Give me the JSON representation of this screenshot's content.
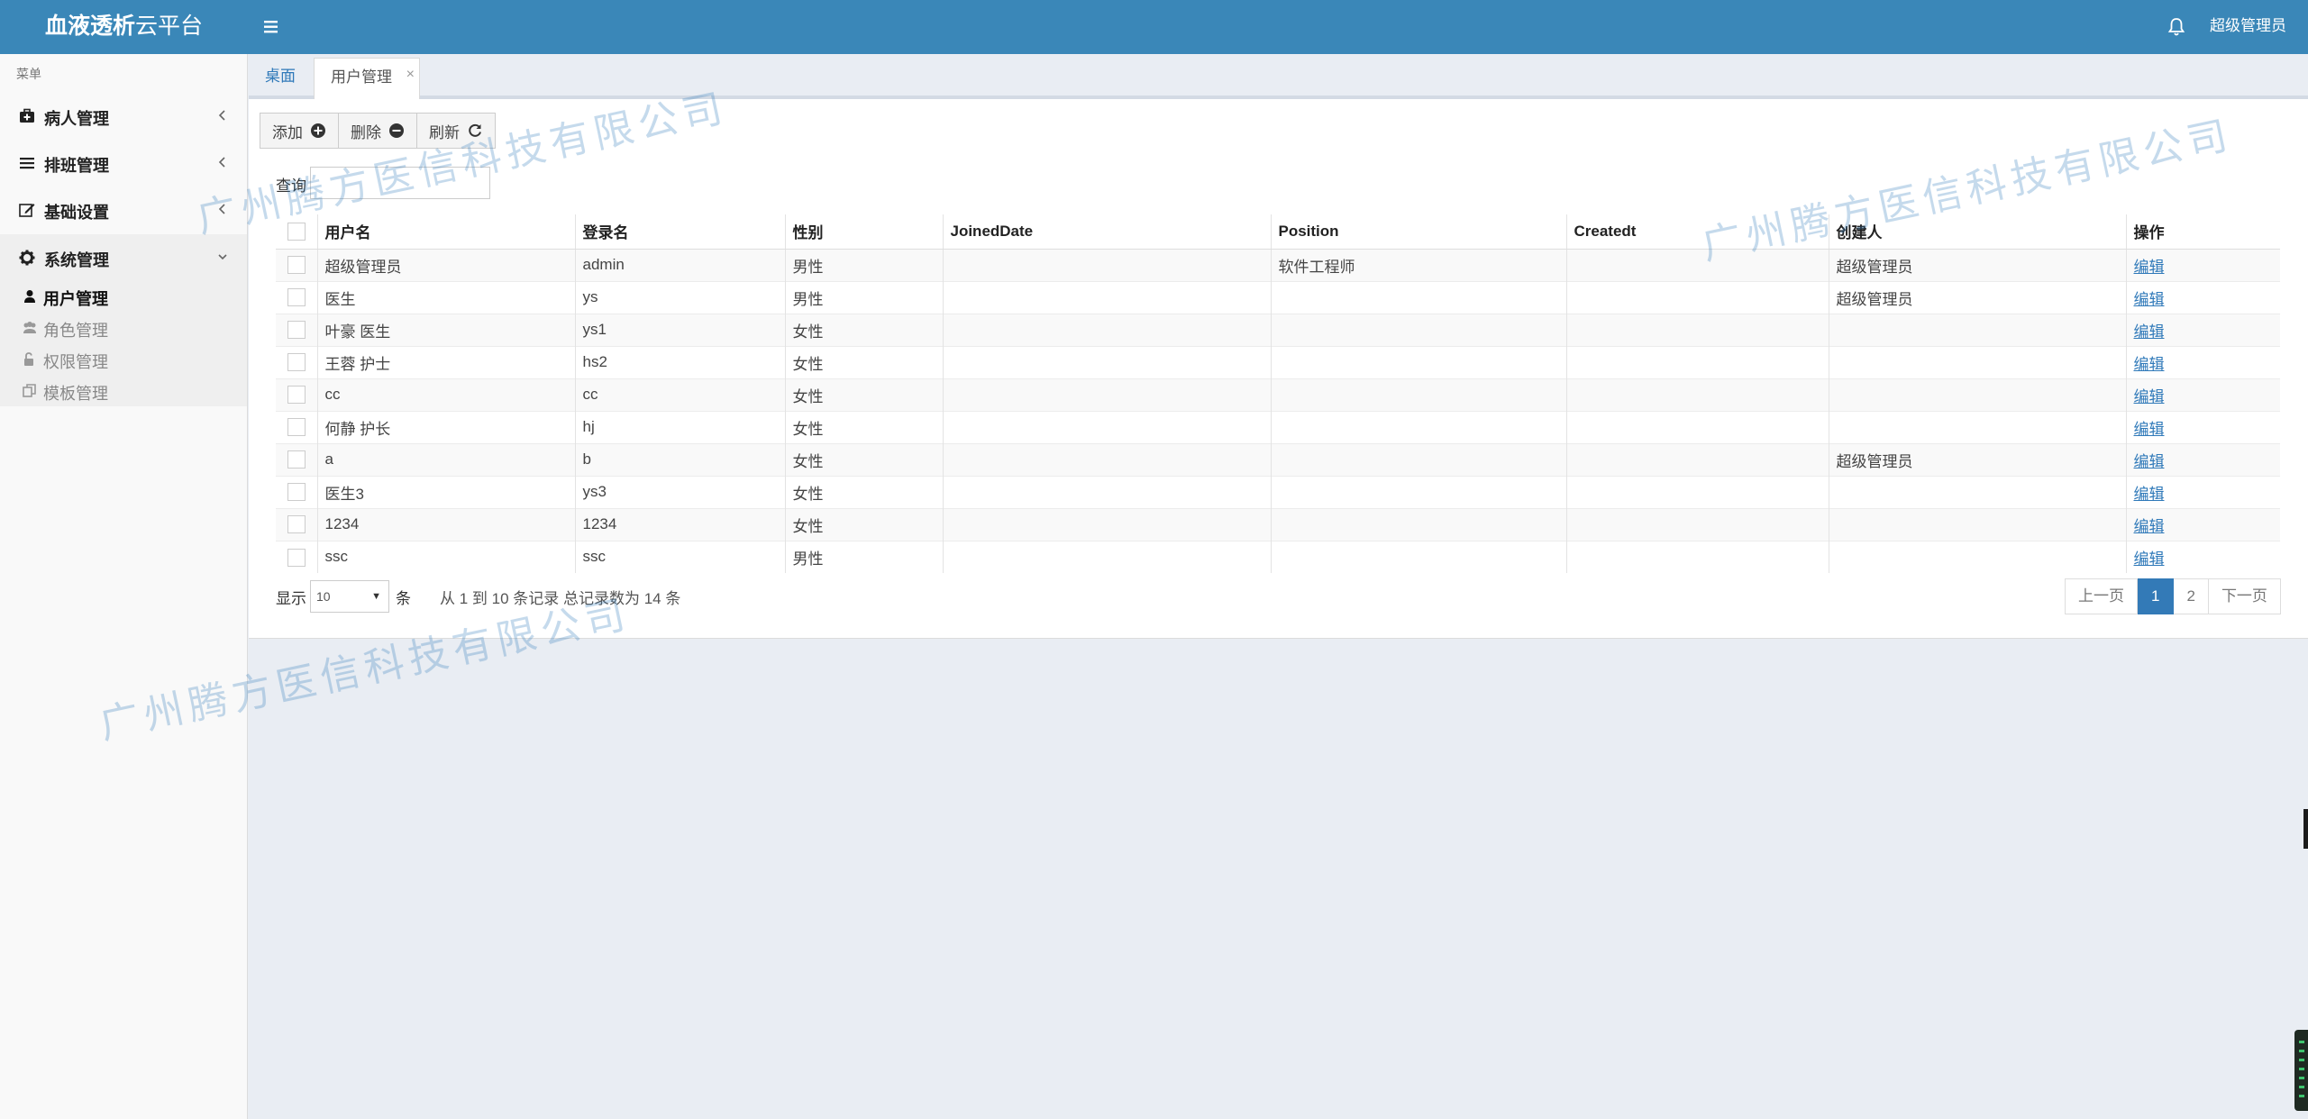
{
  "header": {
    "logo_bold": "血液透析",
    "logo_light": "云平台",
    "user": "超级管理员"
  },
  "sidebar": {
    "caption": "菜单",
    "items": [
      {
        "label": "病人管理",
        "icon": "medkit-icon"
      },
      {
        "label": "排班管理",
        "icon": "list-icon"
      },
      {
        "label": "基础设置",
        "icon": "edit-icon"
      },
      {
        "label": "系统管理",
        "icon": "gear-icon"
      }
    ],
    "subitems": [
      {
        "label": "用户管理",
        "icon": "user-icon"
      },
      {
        "label": "角色管理",
        "icon": "users-icon"
      },
      {
        "label": "权限管理",
        "icon": "unlock-icon"
      },
      {
        "label": "模板管理",
        "icon": "copy-icon"
      }
    ]
  },
  "tabs": {
    "home": "桌面",
    "users": "用户管理",
    "close": "×"
  },
  "toolbar": {
    "add": "添加",
    "delete": "删除",
    "refresh": "刷新",
    "query_label": "查询",
    "query_value": ""
  },
  "table": {
    "columns": [
      "用户名",
      "登录名",
      "性别",
      "JoinedDate",
      "Position",
      "Createdt",
      "创建人",
      "操作"
    ],
    "rows": [
      [
        "超级管理员",
        "admin",
        "男性",
        "",
        "软件工程师",
        "",
        "超级管理员",
        "编辑"
      ],
      [
        "医生",
        "ys",
        "男性",
        "",
        "",
        "",
        "超级管理员",
        "编辑"
      ],
      [
        "叶豪 医生",
        "ys1",
        "女性",
        "",
        "",
        "",
        "",
        "编辑"
      ],
      [
        "王蓉 护士",
        "hs2",
        "女性",
        "",
        "",
        "",
        "",
        "编辑"
      ],
      [
        "cc",
        "cc",
        "女性",
        "",
        "",
        "",
        "",
        "编辑"
      ],
      [
        "何静 护长",
        "hj",
        "女性",
        "",
        "",
        "",
        "",
        "编辑"
      ],
      [
        "a",
        "b",
        "女性",
        "",
        "",
        "",
        "超级管理员",
        "编辑"
      ],
      [
        "医生3",
        "ys3",
        "女性",
        "",
        "",
        "",
        "",
        "编辑"
      ],
      [
        "1234",
        "1234",
        "女性",
        "",
        "",
        "",
        "",
        "编辑"
      ],
      [
        "ssc",
        "ssc",
        "男性",
        "",
        "",
        "",
        "",
        "编辑"
      ]
    ]
  },
  "footer": {
    "show": "显示",
    "page_size": "10",
    "unit": "条",
    "summary": "从 1 到 10 条记录 总记录数为 14 条",
    "prev": "上一页",
    "pages": [
      "1",
      "2"
    ],
    "next": "下一页"
  },
  "watermark": "广州腾方医信科技有限公司",
  "colors": {
    "header": "#3a87b8",
    "link": "#2f79b9",
    "active_page": "#337ab7"
  }
}
